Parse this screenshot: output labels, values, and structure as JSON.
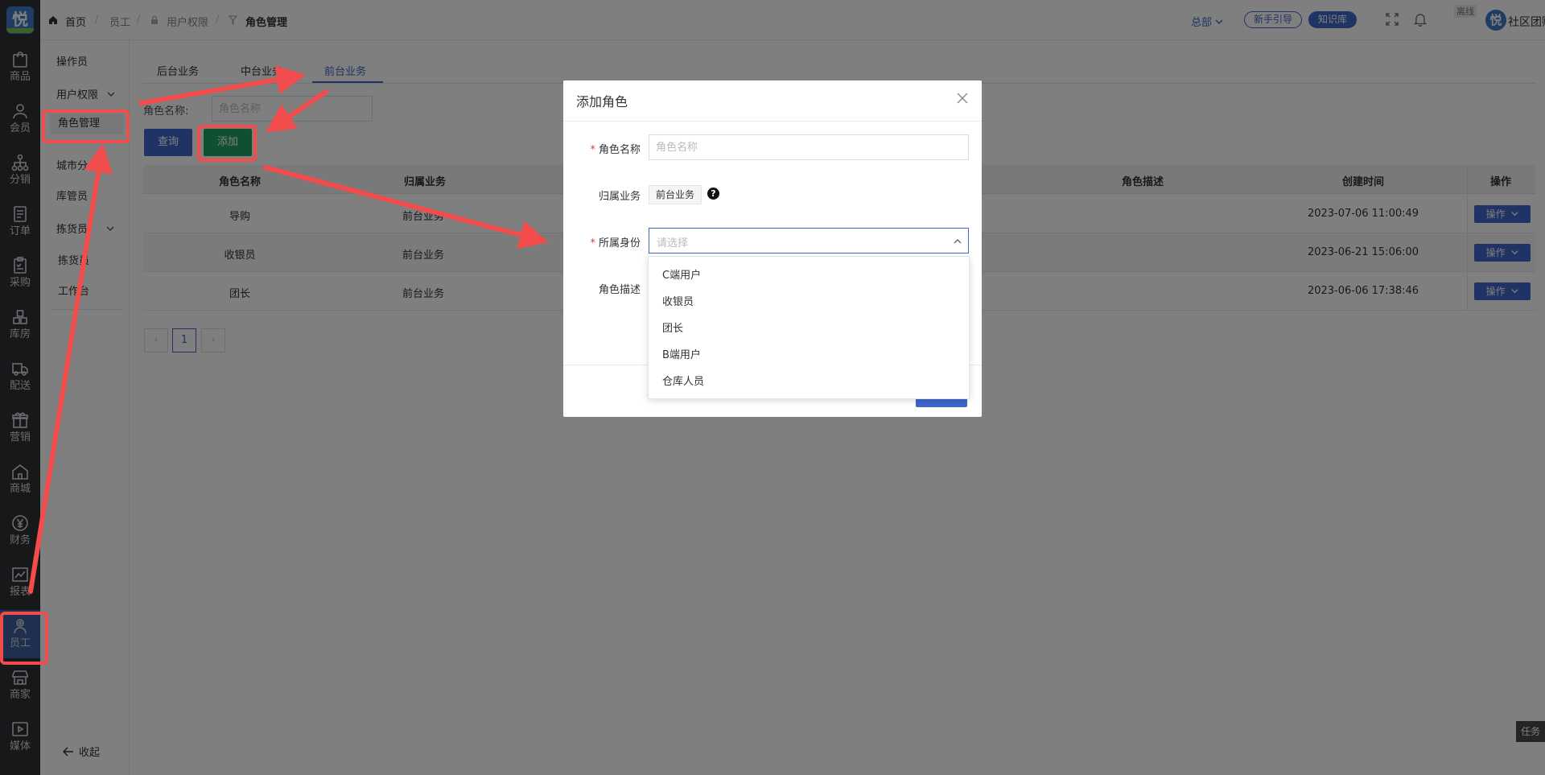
{
  "rail": {
    "logo": "悦",
    "items": [
      {
        "label": "商品",
        "icon": "bag-icon"
      },
      {
        "label": "会员",
        "icon": "user-icon"
      },
      {
        "label": "分销",
        "icon": "network-icon"
      },
      {
        "label": "订单",
        "icon": "order-icon"
      },
      {
        "label": "采购",
        "icon": "clipboard-icon"
      },
      {
        "label": "库房",
        "icon": "warehouse-icon"
      },
      {
        "label": "配送",
        "icon": "truck-icon"
      },
      {
        "label": "营销",
        "icon": "gift-icon"
      },
      {
        "label": "商城",
        "icon": "home-icon"
      },
      {
        "label": "财务",
        "icon": "yen-icon"
      },
      {
        "label": "报表",
        "icon": "chart-icon"
      },
      {
        "label": "员工",
        "icon": "staff-icon"
      },
      {
        "label": "商家",
        "icon": "store-icon"
      },
      {
        "label": "媒体",
        "icon": "play-icon"
      }
    ]
  },
  "subnav": {
    "items": [
      "操作员",
      "用户权限",
      "角色管理",
      "城市分",
      "库管员",
      "拣货员",
      "拣货员",
      "工作台"
    ],
    "collapse": "收起"
  },
  "breadcrumb": {
    "home": "首页",
    "staff": "员工",
    "perm": "用户权限",
    "current": "角色管理"
  },
  "topbar": {
    "branch": "总部",
    "guide": "新手引导",
    "kb": "知识库",
    "offline": "离线",
    "avatar": "悦",
    "org": "社区团购"
  },
  "tabs": [
    "后台业务",
    "中台业务",
    "前台业务"
  ],
  "filter": {
    "label": "角色名称:",
    "placeholder": "角色名称"
  },
  "buttons": {
    "query": "查询",
    "add": "添加"
  },
  "table": {
    "headers": [
      "角色名称",
      "归属业务",
      "角色描述",
      "创建时间",
      "操作"
    ],
    "rows": [
      {
        "name": "导购",
        "biz": "前台业务",
        "time": "2023-07-06 11:00:49",
        "op": "操作"
      },
      {
        "name": "收银员",
        "biz": "前台业务",
        "time": "2023-06-21 15:06:00",
        "op": "操作"
      },
      {
        "name": "团长",
        "biz": "前台业务",
        "time": "2023-06-06 17:38:46",
        "op": "操作"
      }
    ]
  },
  "pagination": {
    "prev": "‹",
    "page": "1",
    "next": "›"
  },
  "task": "任务",
  "dialog": {
    "title": "添加角色",
    "name_label": "角色名称",
    "name_placeholder": "角色名称",
    "biz_label": "归属业务",
    "biz_value": "前台业务",
    "identity_label": "所属身份",
    "identity_placeholder": "请选择",
    "desc_label": "角色描述",
    "options": [
      "C端用户",
      "收银员",
      "团长",
      "B端用户",
      "仓库人员"
    ]
  },
  "colors": {
    "primary": "#3f67c9",
    "add": "#20a060",
    "annotation": "#f24c4c"
  }
}
